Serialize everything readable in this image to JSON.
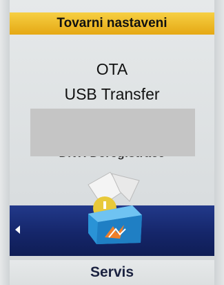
{
  "header": {
    "title": "Tovarni nastaveni"
  },
  "menu": {
    "items": [
      {
        "label": "OTA"
      },
      {
        "label": "USB Transfer"
      },
      {
        "label": "DivX Deregistrace"
      }
    ]
  },
  "footer": {
    "label": "Servis"
  },
  "icons": {
    "nav_left": "left-arrow-icon",
    "category": "service-box-icon"
  },
  "colors": {
    "header": "#f2c230",
    "nav_bar": "#1a2e78",
    "redaction": "#c5c5c5"
  }
}
